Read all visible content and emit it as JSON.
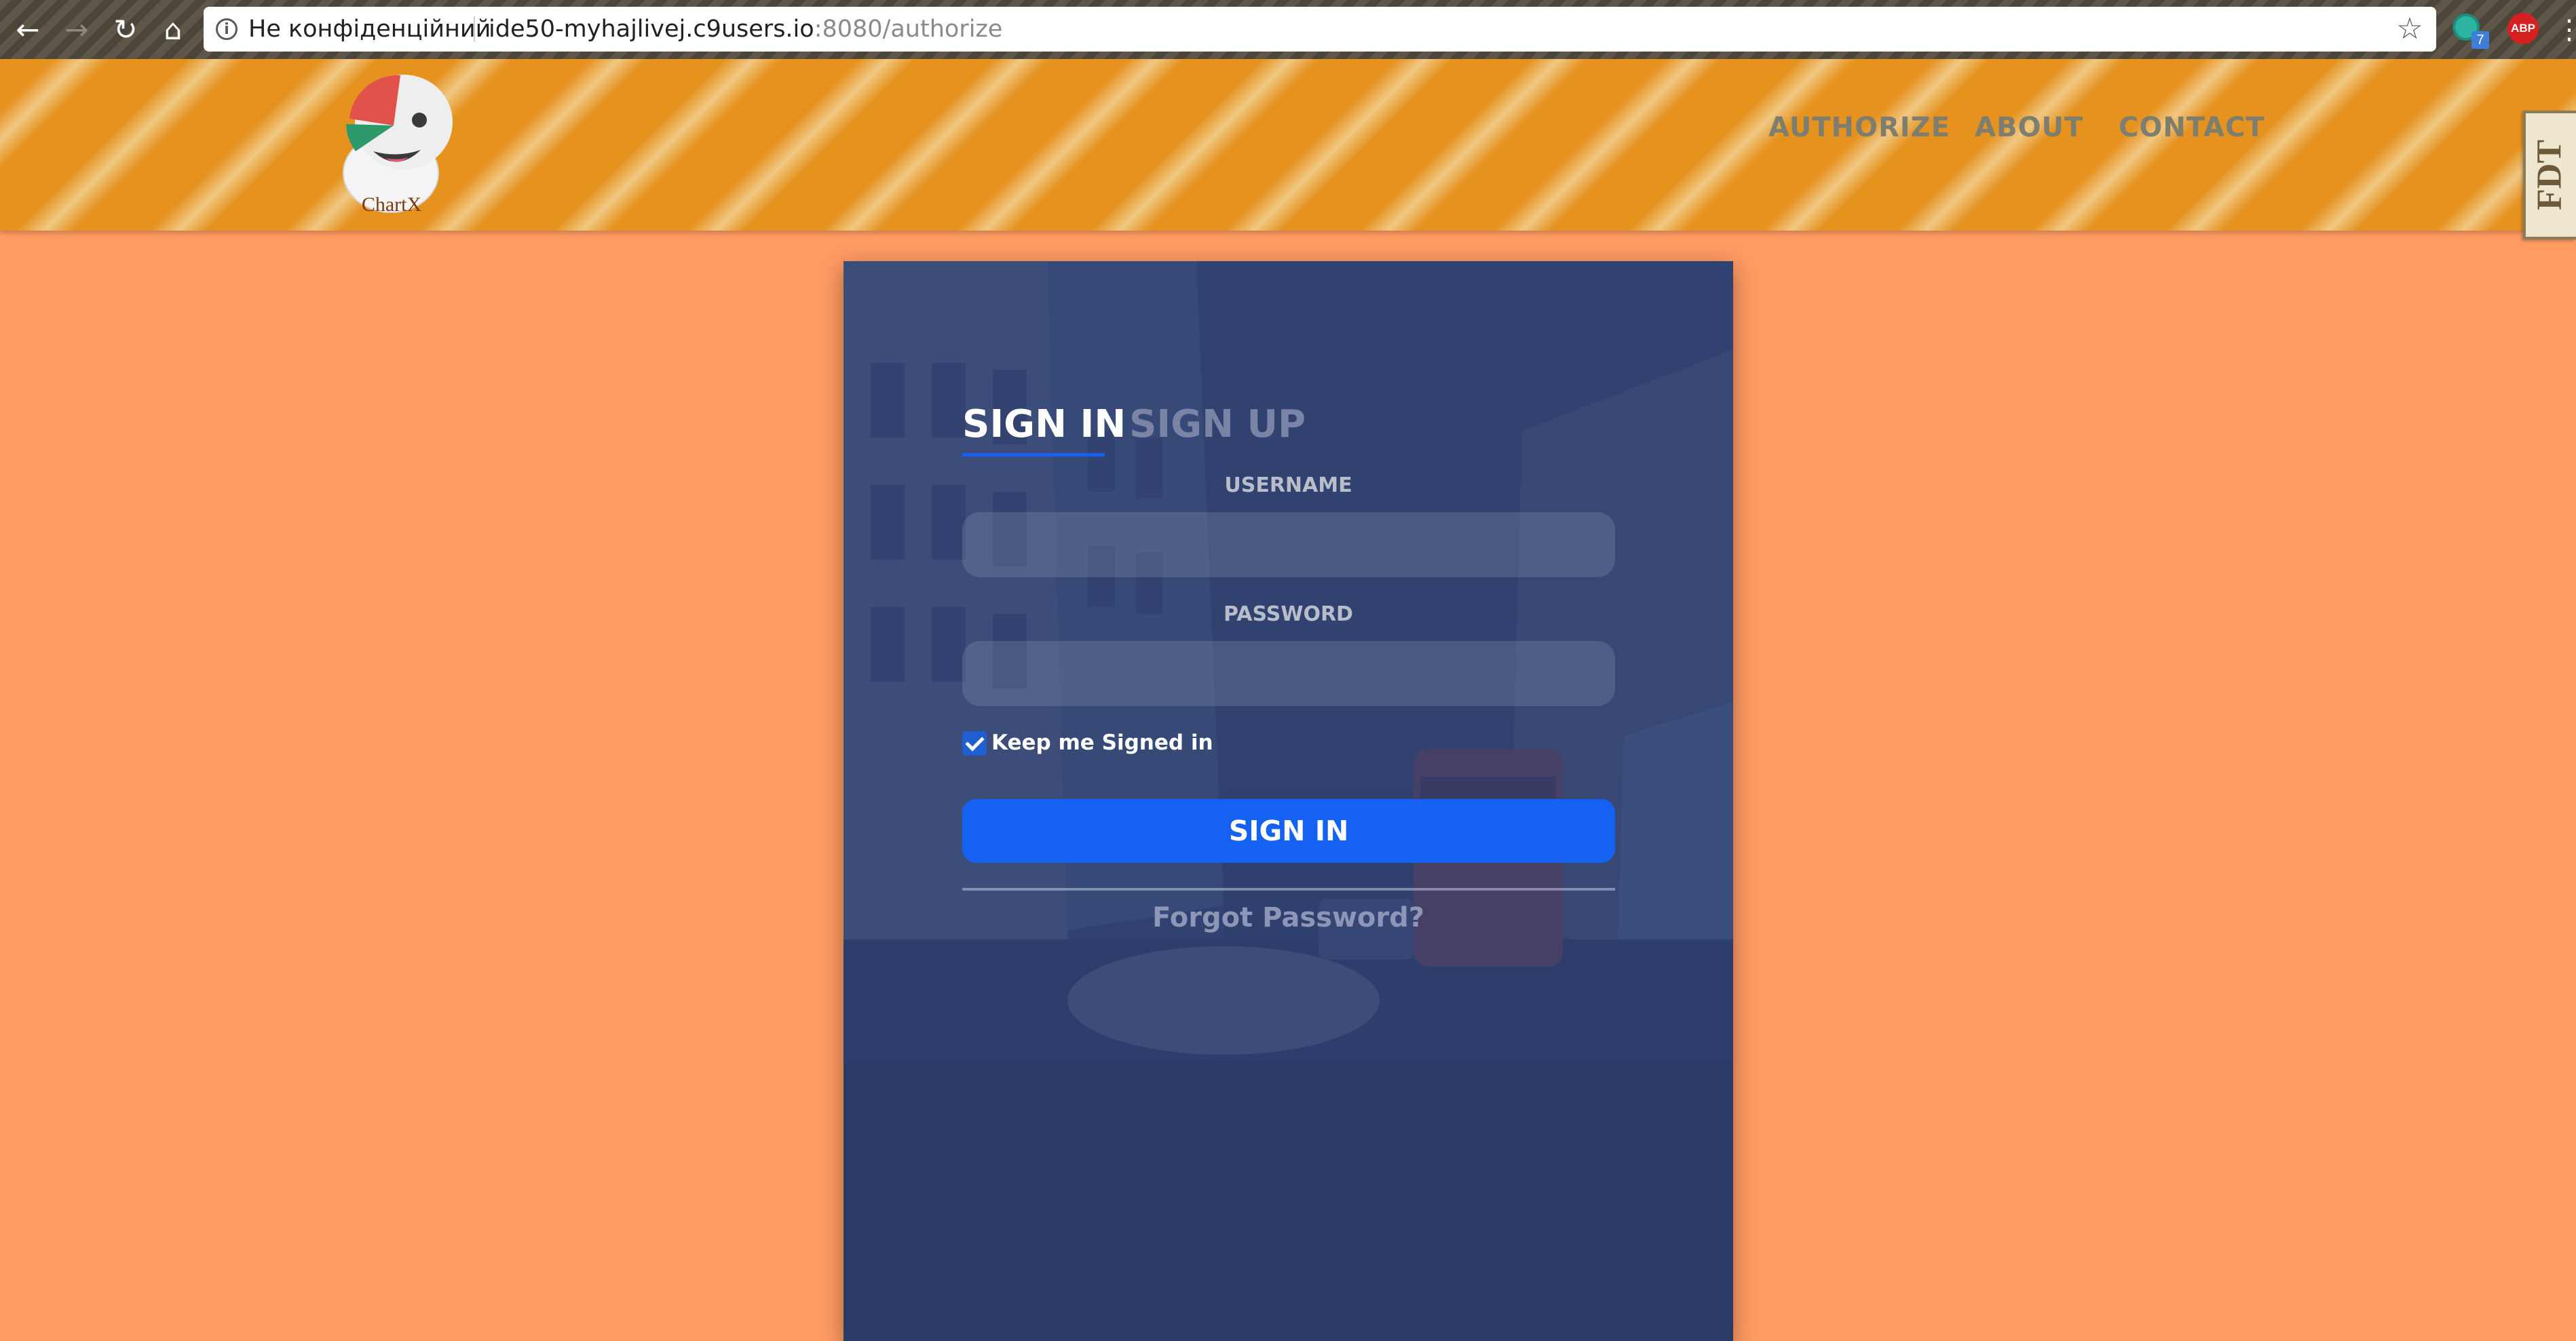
{
  "browser": {
    "security_label": "Не конфіденційний",
    "url_host": "ide50-myhajlivej.c9users.io",
    "url_rest": ":8080/authorize",
    "extension_badge": "7",
    "adblock_label": "ABP"
  },
  "header": {
    "logo_text": "ChartX",
    "nav": [
      "AUTHORIZE",
      "ABOUT",
      "CONTACT"
    ],
    "side_widget_label": "FDT"
  },
  "login": {
    "tabs": {
      "sign_in": "SIGN IN",
      "sign_up": "SIGN UP"
    },
    "active_tab": "SIGN IN",
    "username_label": "USERNAME",
    "username_value": "",
    "password_label": "PASSWORD",
    "password_value": "",
    "keep_signed_in_label": "Keep me Signed in",
    "keep_signed_in_checked": true,
    "submit_label": "SIGN IN",
    "forgot_label": "Forgot Password?"
  },
  "colors": {
    "page_background": "#fe9a62",
    "header_stripe": "#e6921f",
    "card_overlay": "#34487a",
    "primary_button": "#1461f2",
    "nav_text": "#7e7e6f"
  },
  "icons": [
    "back-icon",
    "forward-icon",
    "reload-icon",
    "home-icon",
    "info-icon",
    "star-icon",
    "extension-icon",
    "adblock-icon",
    "menu-icon"
  ]
}
